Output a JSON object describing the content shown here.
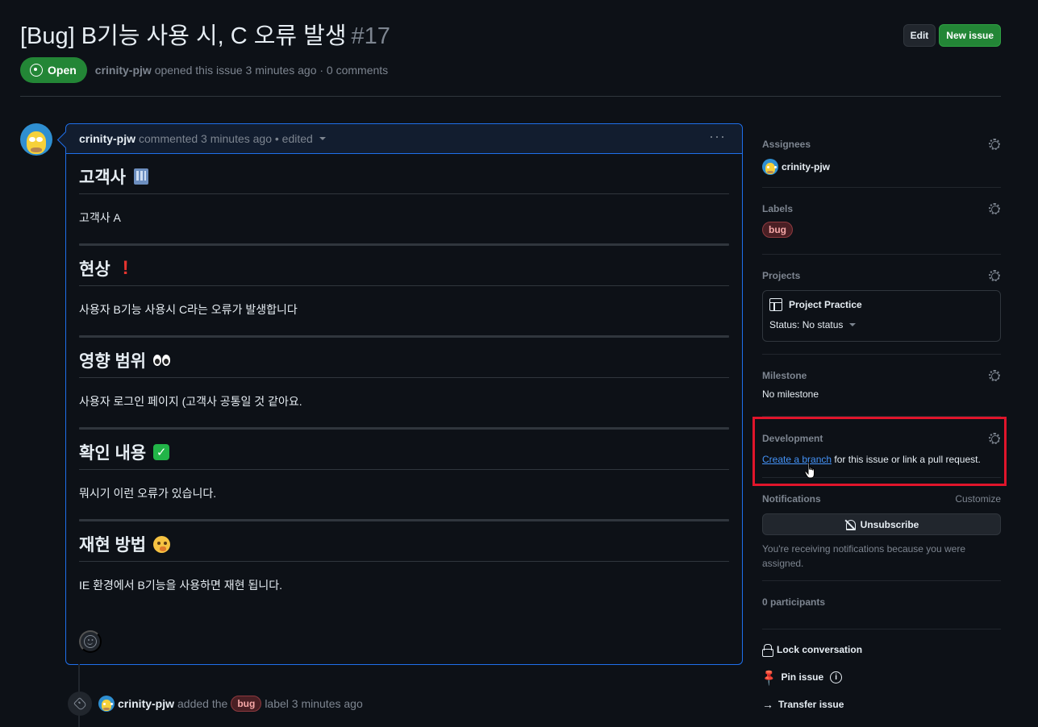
{
  "header": {
    "title": "[Bug] B기능 사용 시, C 오류 발생",
    "number": "#17",
    "edit_label": "Edit",
    "new_issue_label": "New issue",
    "state": "Open",
    "author": "crinity-pjw",
    "meta_text": "opened this issue 3 minutes ago · 0 comments"
  },
  "comment": {
    "author": "crinity-pjw",
    "meta": "commented 3 minutes ago • edited",
    "sections": [
      {
        "heading": "고객사",
        "text": "고객사 A",
        "emoji": "office-building-emoji"
      },
      {
        "heading": "현상",
        "text": "사용자 B기능 사용시 C라는 오류가 발생합니다",
        "emoji": "exclamation-emoji"
      },
      {
        "heading": "영향 범위",
        "text": "사용자 로그인 페이지 (고객사 공통일 것 같아요.",
        "emoji": "eyes-emoji"
      },
      {
        "heading": "확인 내용",
        "text": "뭐시기 이런 오류가 있습니다.",
        "emoji": "check-mark-emoji"
      },
      {
        "heading": "재현 방법",
        "text": "IE 환경에서 B기능을 사용하면 재현 됩니다.",
        "emoji": "thinking-face-emoji"
      }
    ],
    "check_glyph": "✓"
  },
  "event": {
    "author": "crinity-pjw",
    "text_before": "added the",
    "label": "bug",
    "text_after": "label 3 minutes ago"
  },
  "sidebar": {
    "assignees": {
      "heading": "Assignees",
      "name": "crinity-pjw"
    },
    "labels": {
      "heading": "Labels",
      "label": "bug"
    },
    "projects": {
      "heading": "Projects",
      "project_name": "Project Practice",
      "status": "Status: No status"
    },
    "milestone": {
      "heading": "Milestone",
      "value": "No milestone"
    },
    "development": {
      "heading": "Development",
      "link_text": "Create a branch",
      "rest_text": " for this issue or link a pull request."
    },
    "notifications": {
      "heading": "Notifications",
      "customize": "Customize",
      "unsubscribe": "Unsubscribe",
      "note": "You're receiving notifications because you were assigned."
    },
    "participants": "0 participants",
    "actions": {
      "lock": "Lock conversation",
      "pin": "Pin issue",
      "transfer": "Transfer issue",
      "kebab_glyph": "···",
      "pin_glyph": "📌",
      "info_glyph": "i",
      "arrow_glyph": "→"
    }
  },
  "colors": {
    "background": "#0d1117",
    "open_green": "#238636",
    "link_blue": "#4493f8",
    "highlight_red": "#e0152b",
    "bug_label_bg": "#4a1f24",
    "bug_label_text": "#f7a8a8"
  }
}
